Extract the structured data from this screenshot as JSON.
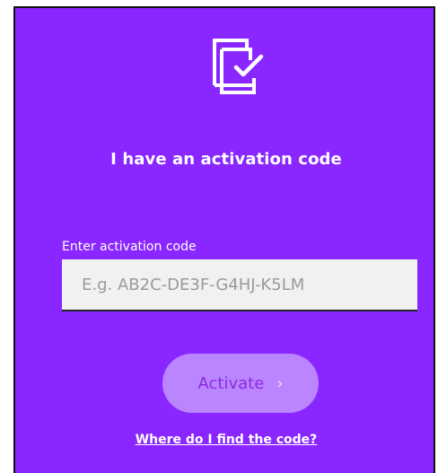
{
  "header": {
    "logo_icon": "book-check-icon",
    "title": "I have an activation code"
  },
  "form": {
    "field_label": "Enter activation code",
    "placeholder": "E.g. AB2C-DE3F-G4HJ-K5LM",
    "value": "",
    "activate_label": "Activate",
    "activate_icon": "chevron-right-icon"
  },
  "help": {
    "link_text": "Where do I find the code?"
  },
  "colors": {
    "background": "#8a26ff",
    "button": "#bb85ff",
    "button_text": "#8a2be2",
    "input_bg": "#f1f1f1"
  }
}
